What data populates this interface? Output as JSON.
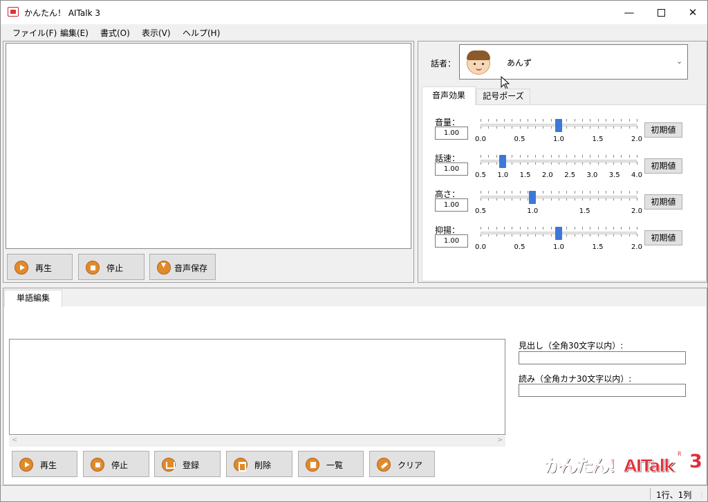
{
  "window": {
    "title": "かんたん！ AITalk 3"
  },
  "menu": [
    "ファイル(F)",
    "編集(E)",
    "書式(O)",
    "表示(V)",
    "ヘルプ(H)"
  ],
  "playback": {
    "play": "再生",
    "stop": "停止",
    "save": "音声保存"
  },
  "speaker": {
    "label": "話者：",
    "name": "あんず"
  },
  "tabs": {
    "effects": "音声効果",
    "pause": "記号ポーズ"
  },
  "sliders": [
    {
      "label": "音量：",
      "value": "1.00",
      "min": 0,
      "max": 2,
      "pos": 1.0,
      "ticks": [
        "0.0",
        "0.5",
        "1.0",
        "1.5",
        "2.0"
      ],
      "reset": "初期値"
    },
    {
      "label": "話速：",
      "value": "1.00",
      "min": 0.5,
      "max": 4,
      "pos": 1.0,
      "ticks": [
        "0.5",
        "1.0",
        "1.5",
        "2.0",
        "2.5",
        "3.0",
        "3.5",
        "4.0"
      ],
      "reset": "初期値"
    },
    {
      "label": "高さ：",
      "value": "1.00",
      "min": 0.5,
      "max": 2,
      "pos": 1.0,
      "ticks": [
        "0.5",
        "1.0",
        "1.5",
        "2.0"
      ],
      "reset": "初期値"
    },
    {
      "label": "抑揚：",
      "value": "1.00",
      "min": 0,
      "max": 2,
      "pos": 1.0,
      "ticks": [
        "0.0",
        "0.5",
        "1.0",
        "1.5",
        "2.0"
      ],
      "reset": "初期値"
    }
  ],
  "word_edit": {
    "tab": "単語編集",
    "heading_label": "見出し（全角30文字以内）:",
    "heading_value": "",
    "reading_label": "読み（全角カナ30文字以内）:",
    "reading_value": "",
    "buttons": {
      "play": "再生",
      "stop": "停止",
      "register": "登録",
      "delete": "削除",
      "list": "一覧",
      "clear": "クリア"
    }
  },
  "logo": {
    "text": "かんたん！AITalk",
    "version": "3",
    "mark": "R"
  },
  "status": {
    "position": "1行、1列"
  }
}
